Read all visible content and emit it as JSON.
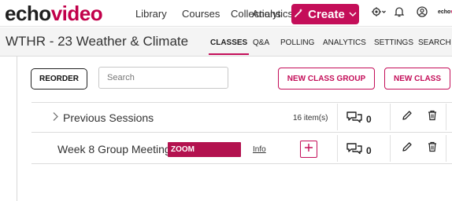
{
  "brand": {
    "logo_echo": "echo",
    "logo_video": "video",
    "mini_echo": "echo",
    "mini_video": "v"
  },
  "nav": {
    "library": "Library",
    "courses": "Courses",
    "collections": "Collections",
    "analytics": "Analytics",
    "create_label": "Create"
  },
  "icons": {
    "create": "magic-wand-icon",
    "create_menu": "chevron-down-icon",
    "settings": "gear-icon",
    "notifications": "bell-icon",
    "account": "user-icon",
    "expand": "chevron-right-icon",
    "discussion": "chat-bubbles-icon",
    "edit": "pencil-icon",
    "delete": "trash-icon",
    "add": "plus-icon"
  },
  "course": {
    "title": "WTHR - 23 Weather & Climate",
    "tabs": [
      {
        "label": "CLASSES",
        "active": true
      },
      {
        "label": "Q&A"
      },
      {
        "label": "POLLING"
      },
      {
        "label": "ANALYTICS"
      },
      {
        "label": "SETTINGS"
      },
      {
        "label": "SEARCH"
      }
    ]
  },
  "toolbar": {
    "reorder_label": "REORDER",
    "search_placeholder": "Search",
    "new_group_label": "NEW CLASS GROUP",
    "new_class_label": "NEW CLASS"
  },
  "rows": [
    {
      "title": "Previous Sessions",
      "items_label": "16 item(s)",
      "discussion_count": "0"
    },
    {
      "title": "Week 8 Group Meeting",
      "badge": "ZOOM",
      "info_label": "Info",
      "discussion_count": "0"
    }
  ],
  "colors": {
    "brand": "#c40e59",
    "badge": "#b3124f"
  }
}
